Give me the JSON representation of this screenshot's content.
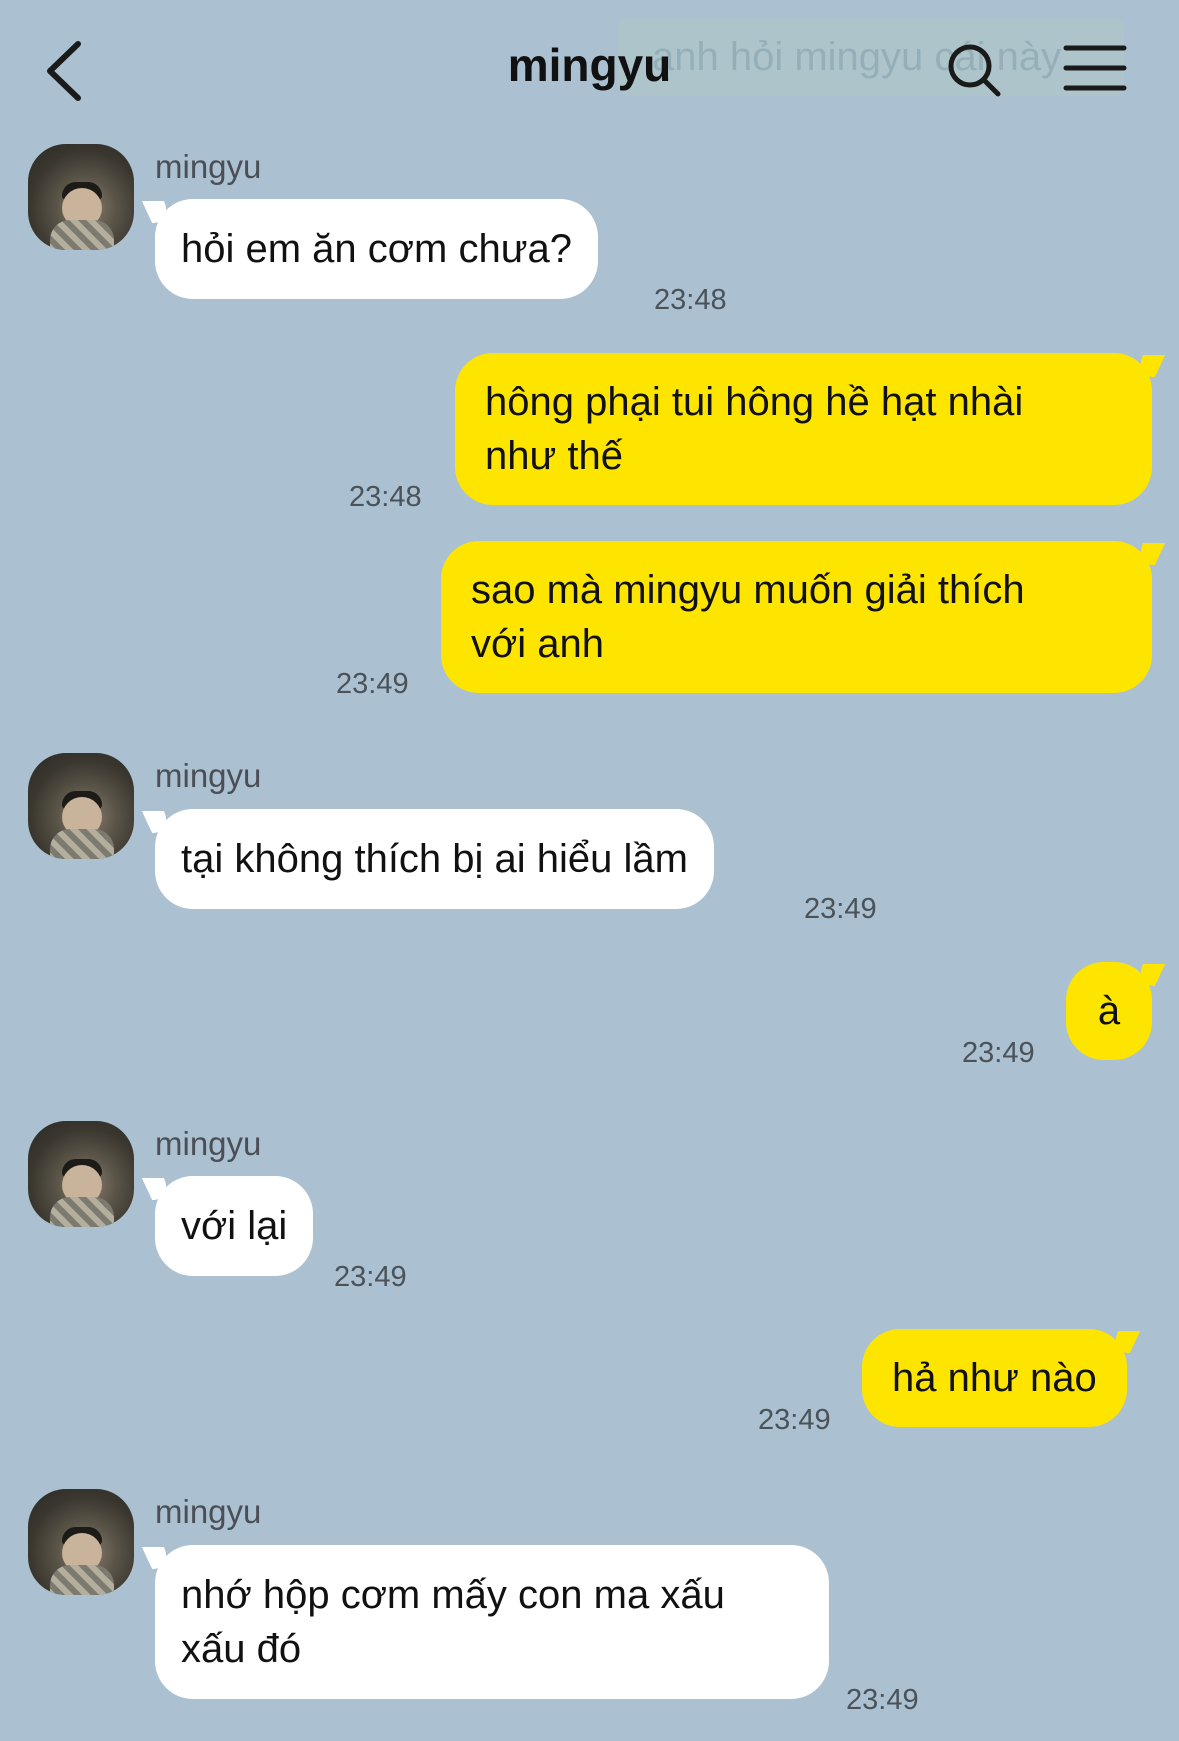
{
  "header": {
    "title": "mingyu",
    "ghost_text": "anh hỏi mingyu cái này",
    "icons": {
      "back": "chevron-left-icon",
      "search": "search-icon",
      "menu": "hamburger-menu-icon"
    }
  },
  "colors": {
    "background": "#abc1d1",
    "incoming_bubble": "#ffffff",
    "outgoing_bubble": "#fee500"
  },
  "messages": [
    {
      "direction": "in",
      "sender": "mingyu",
      "text": "hỏi em ăn cơm chưa?",
      "time": "23:48"
    },
    {
      "direction": "out",
      "lines": [
        "hông phại tui hông hề hạt nhài",
        "như thế"
      ],
      "time": "23:48"
    },
    {
      "direction": "out",
      "lines": [
        "sao mà mingyu muốn giải thích",
        "với anh"
      ],
      "time": "23:49"
    },
    {
      "direction": "in",
      "sender": "mingyu",
      "text": "tại không thích bị ai hiểu lầm",
      "time": "23:49"
    },
    {
      "direction": "out",
      "text": "à",
      "time": "23:49"
    },
    {
      "direction": "in",
      "sender": "mingyu",
      "text": "với lại",
      "time": "23:49"
    },
    {
      "direction": "out",
      "text": "hả như nào",
      "time": "23:49"
    },
    {
      "direction": "in",
      "sender": "mingyu",
      "lines": [
        "nhớ hộp cơm mấy con ma xấu",
        "xấu đó"
      ],
      "time": "23:49"
    }
  ]
}
